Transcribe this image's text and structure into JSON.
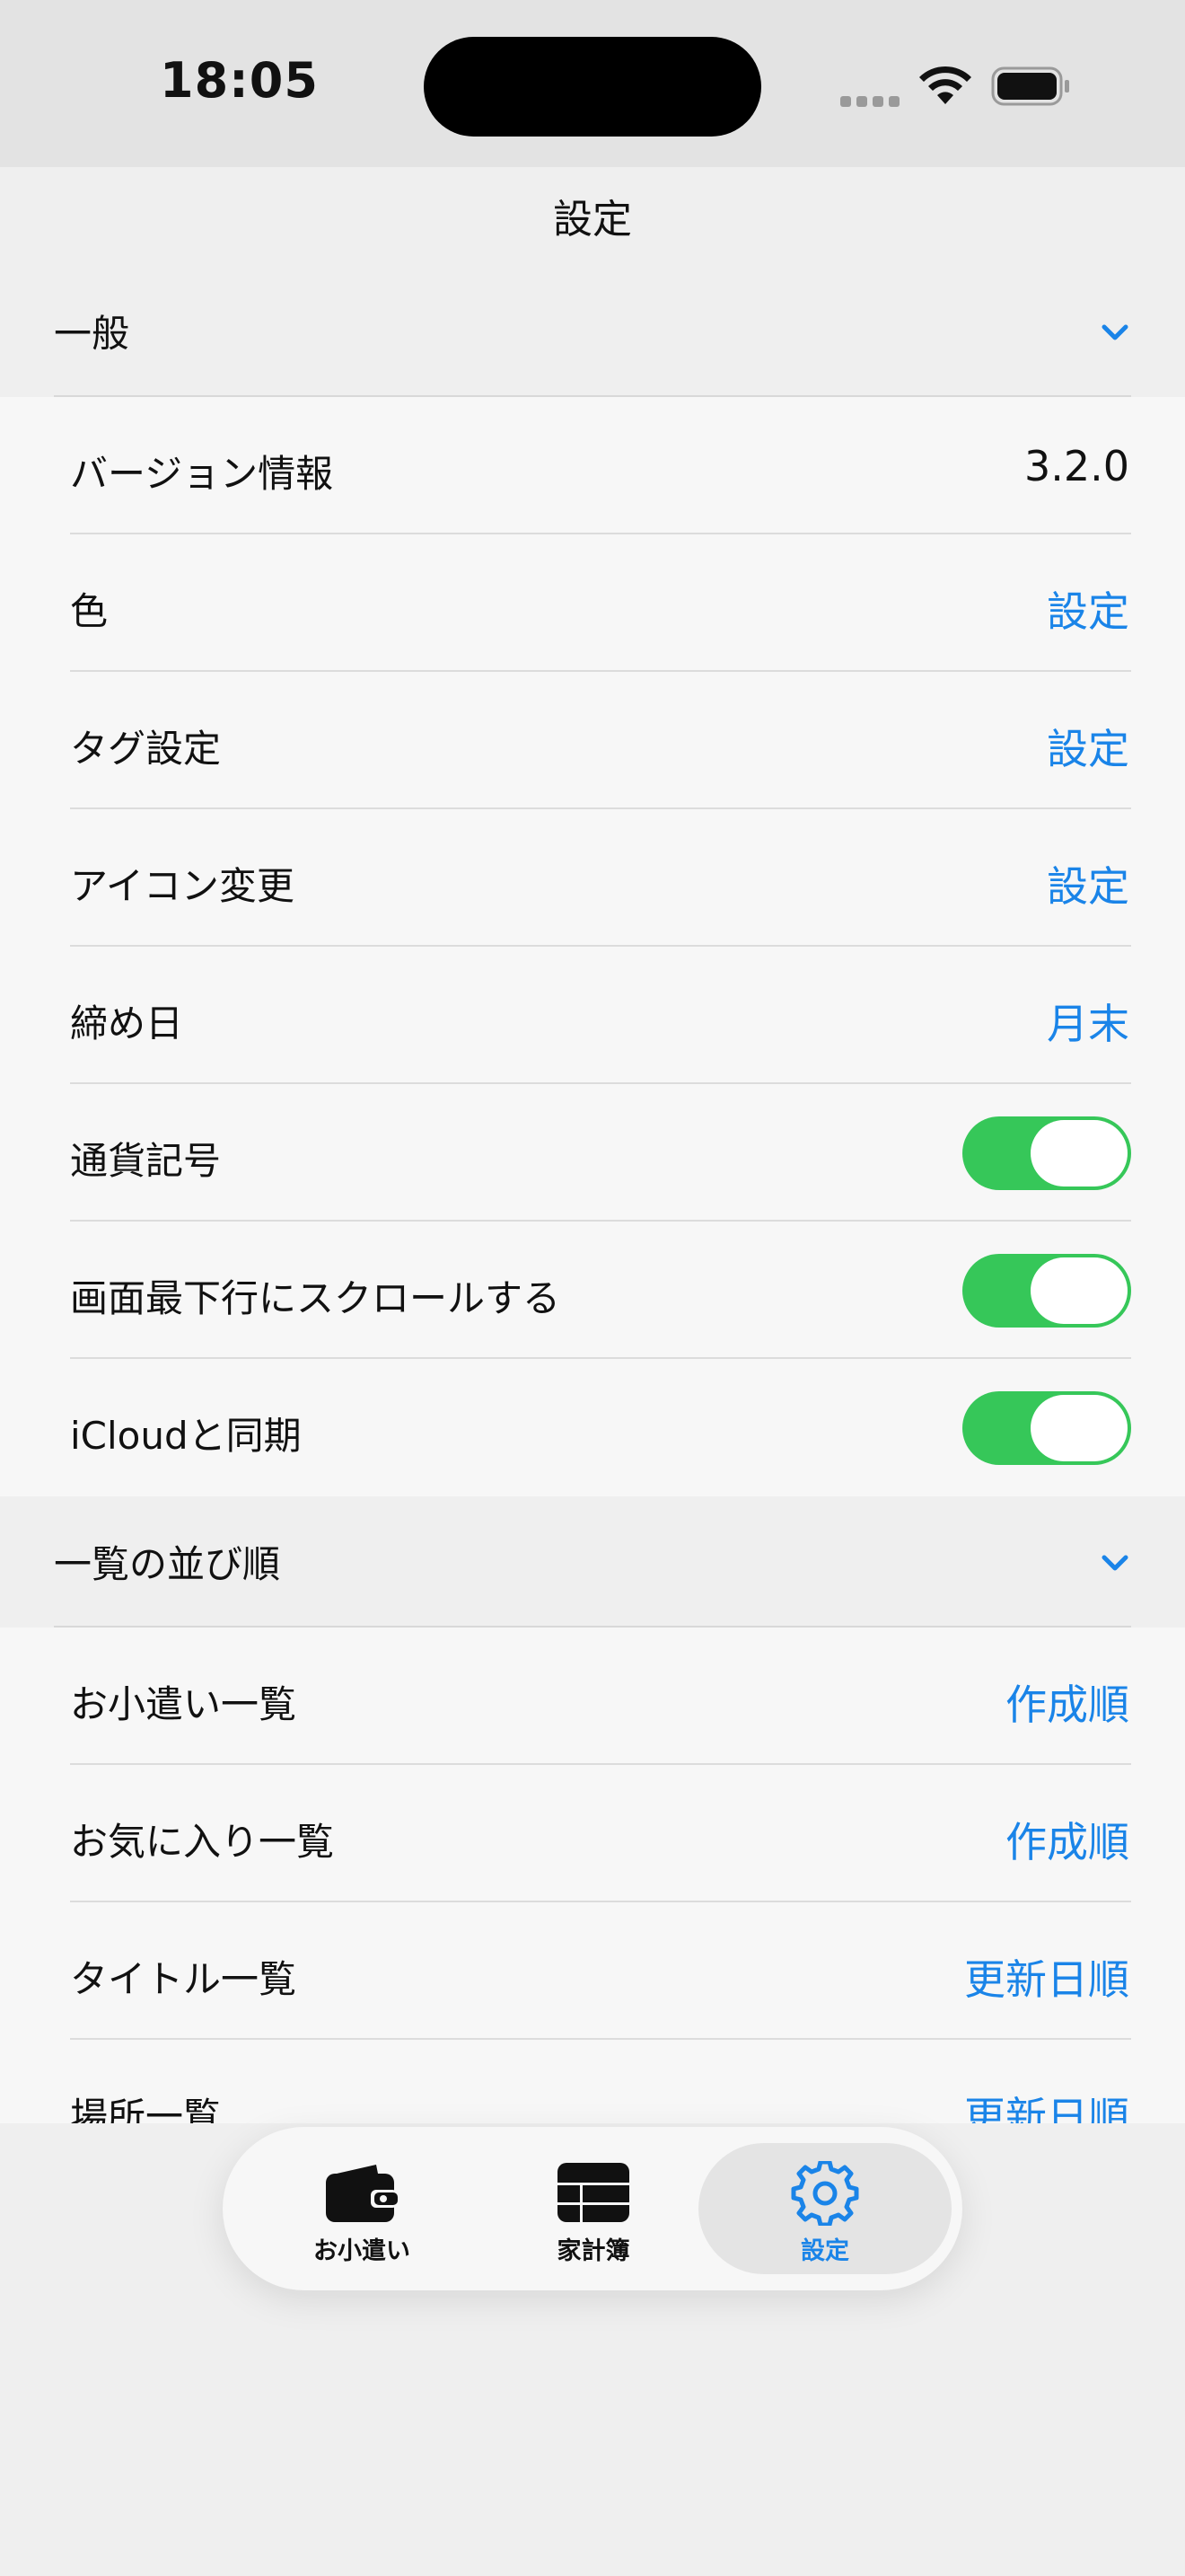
{
  "status": {
    "time": "18:05"
  },
  "nav": {
    "title": "設定"
  },
  "sections": [
    {
      "title": "一般",
      "rows": [
        {
          "label": "バージョン情報",
          "value": "3.2.0"
        },
        {
          "label": "色",
          "value": "設定"
        },
        {
          "label": "タグ設定",
          "value": "設定"
        },
        {
          "label": "アイコン変更",
          "value": "設定"
        },
        {
          "label": "締め日",
          "value": "月末"
        },
        {
          "label": "通貨記号",
          "toggle": true
        },
        {
          "label": "画面最下行にスクロールする",
          "toggle": true
        },
        {
          "label": "iCloudと同期",
          "toggle": true
        }
      ]
    },
    {
      "title": "一覧の並び順",
      "rows": [
        {
          "label": "お小遣い一覧",
          "value": "作成順"
        },
        {
          "label": "お気に入り一覧",
          "value": "作成順"
        },
        {
          "label": "タイトル一覧",
          "value": "更新日順"
        },
        {
          "label": "場所一覧",
          "value": "更新日順"
        }
      ]
    }
  ],
  "tabs": [
    {
      "label": "お小遣い",
      "icon": "wallet-icon"
    },
    {
      "label": "家計簿",
      "icon": "table-icon"
    },
    {
      "label": "設定",
      "icon": "gear-icon",
      "active": true
    }
  ],
  "colors": {
    "accent": "#1a84e8",
    "toggle_on": "#36c759"
  }
}
